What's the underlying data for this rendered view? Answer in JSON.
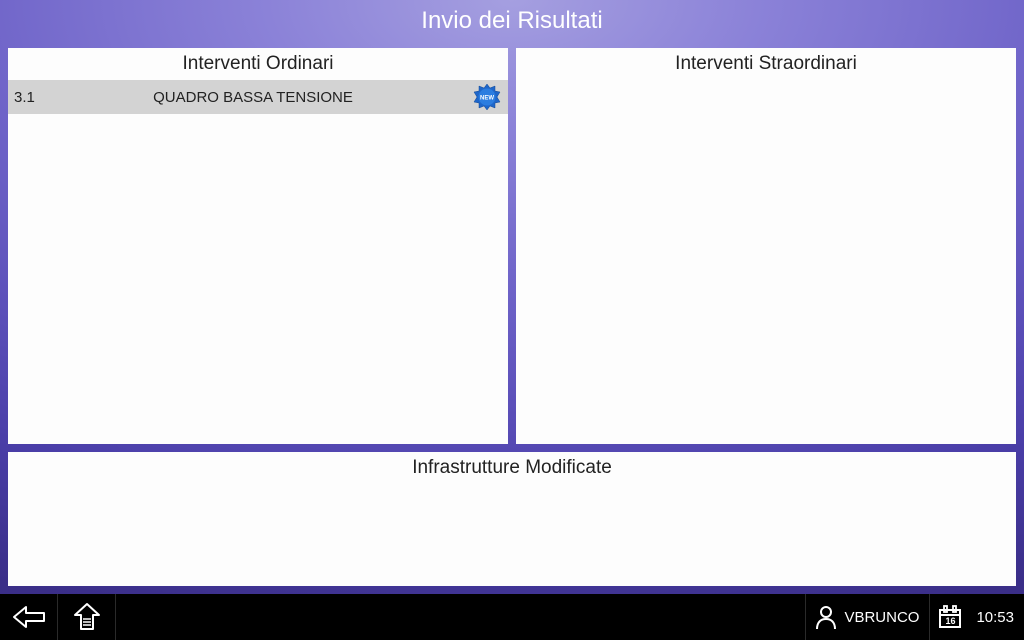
{
  "header": {
    "title": "Invio dei Risultati"
  },
  "panels": {
    "ordinary": {
      "title": "Interventi Ordinari",
      "items": [
        {
          "code": "3.1",
          "label": "QUADRO BASSA TENSIONE",
          "badge": "NEW"
        }
      ]
    },
    "extraordinary": {
      "title": "Interventi Straordinari"
    },
    "infrastructure": {
      "title": "Infrastrutture Modificate"
    }
  },
  "footer": {
    "username": "VBRUNCO",
    "calendar_day": "16",
    "time": "10:53"
  }
}
